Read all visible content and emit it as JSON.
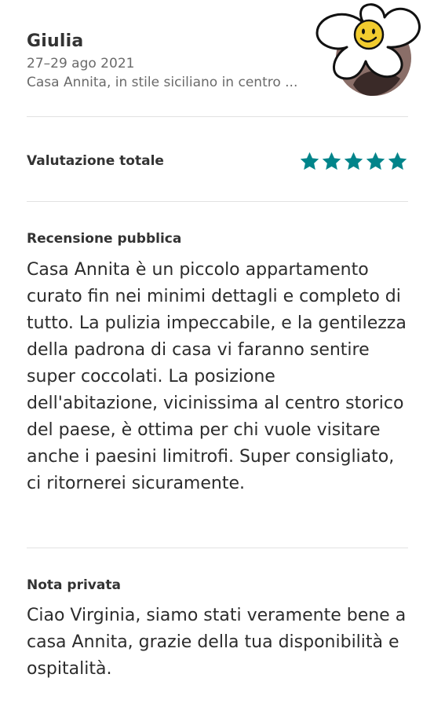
{
  "guest": {
    "name": "Giulia",
    "dates": "27–29 ago 2021",
    "listing": "Casa Annita, in stile siciliano in centro  ..."
  },
  "rating": {
    "label": "Valutazione totale",
    "stars": 5,
    "max": 5,
    "color": "#00848A"
  },
  "public_review": {
    "title": "Recensione pubblica",
    "text": "Casa Annita è un piccolo appartamento curato fin nei minimi dettagli e completo di tutto. La pulizia impeccabile, e la gentilezza della padrona di casa vi faranno sentire super coccolati. La posizione dell'abitazione, vicinissima al centro storico del paese, è ottima per chi vuole visitare anche i paesini limitrofi. Super consigliato, ci ritornerei sicuramente."
  },
  "private_note": {
    "title": "Nota privata",
    "text": "Ciao Virginia, siamo stati veramente bene a casa Annita, grazie della tua disponibilità e ospitalità."
  },
  "icons": {
    "avatar": "flower-smiley-avatar",
    "star": "star-icon"
  }
}
